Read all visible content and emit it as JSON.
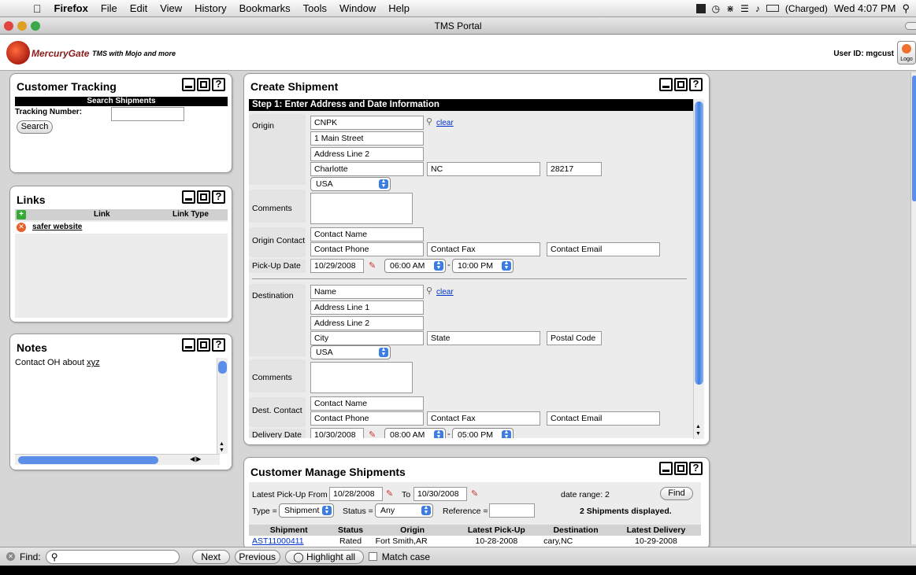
{
  "menubar": {
    "app": "Firefox",
    "items": [
      "File",
      "Edit",
      "View",
      "History",
      "Bookmarks",
      "Tools",
      "Window",
      "Help"
    ],
    "battery": "(Charged)",
    "clock": "Wed 4:07 PM"
  },
  "window": {
    "title": "TMS Portal"
  },
  "header": {
    "logo_text": "MercuryGate",
    "tagline": "TMS with Mojo and more",
    "user_id": "User ID: mgcust",
    "logout": "Logo"
  },
  "tracking": {
    "title": "Customer Tracking",
    "search_header": "Search Shipments",
    "tracking_label": "Tracking Number:",
    "tracking_value": "",
    "search_button": "Search"
  },
  "links": {
    "title": "Links",
    "col_link": "Link",
    "col_type": "Link Type",
    "row1": "safer website"
  },
  "notes": {
    "title": "Notes",
    "text_pre": "Contact OH about ",
    "text_under": "xyz"
  },
  "create": {
    "title": "Create Shipment",
    "step": "Step 1: Enter Address and Date Information",
    "origin_label": "Origin",
    "origin": {
      "name": "CNPK",
      "addr1": "1 Main Street",
      "addr2": "Address Line 2",
      "city": "Charlotte",
      "state": "NC",
      "zip": "28217",
      "country": "USA"
    },
    "clear": "clear",
    "comments_label": "Comments",
    "origin_contact_label": "Origin Contact",
    "origin_contact": {
      "name": "Contact Name",
      "phone": "Contact Phone",
      "fax": "Contact Fax",
      "email": "Contact Email"
    },
    "pickup_label": "Pick-Up Date",
    "pickup_date": "10/29/2008",
    "pickup_from": "06:00 AM",
    "pickup_to": "10:00 PM",
    "dash": "-",
    "dest_label": "Destination",
    "dest": {
      "name": "Name",
      "addr1": "Address Line 1",
      "addr2": "Address Line 2",
      "city": "City",
      "state": "State",
      "zip": "Postal Code",
      "country": "USA"
    },
    "dest_contact_label": "Dest. Contact",
    "dest_contact": {
      "name": "Contact Name",
      "phone": "Contact Phone",
      "fax": "Contact Fax",
      "email": "Contact Email"
    },
    "delivery_label": "Delivery Date",
    "delivery_date": "10/30/2008",
    "delivery_from": "08:00 AM",
    "delivery_to": "05:00 PM"
  },
  "manage": {
    "title": "Customer Manage Shipments",
    "from_label": "Latest Pick-Up From",
    "from_value": "10/28/2008",
    "to_label": "To",
    "to_value": "10/30/2008",
    "date_range": "date range: 2",
    "find": "Find",
    "type_label": "Type =",
    "type_value": "Shipment",
    "status_label": "Status =",
    "status_value": "Any",
    "ref_label": "Reference =",
    "ref_value": "",
    "count": "2 Shipments displayed.",
    "columns": [
      "Shipment",
      "Status",
      "Origin",
      "Latest Pick-Up",
      "Destination",
      "Latest Delivery"
    ],
    "row1": [
      "AST11000411",
      "Rated",
      "Fort Smith,AR",
      "10-28-2008",
      "cary,NC",
      "10-29-2008"
    ]
  },
  "findbar": {
    "label": "Find:",
    "value": "",
    "next": "Next",
    "previous": "Previous",
    "highlight": "Highlight all",
    "match_case": "Match case"
  }
}
